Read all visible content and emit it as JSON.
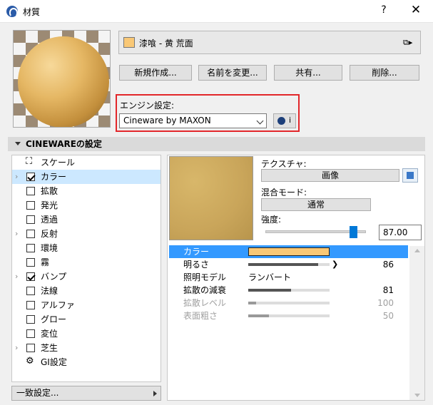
{
  "window": {
    "title": "材質",
    "help": "?",
    "close": "✕"
  },
  "material": {
    "name": "漆喰 - 黄 荒面",
    "swatch_color": "#f9c876"
  },
  "buttons": {
    "new": "新規作成...",
    "rename": "名前を変更...",
    "share": "共有...",
    "delete": "削除..."
  },
  "engine": {
    "label": "エンジン設定:",
    "value": "Cineware by MAXON",
    "info": "i"
  },
  "section": {
    "title": "CINEWAREの設定"
  },
  "channels": [
    {
      "label": "スケール",
      "type": "scale",
      "checked": false,
      "expander": false
    },
    {
      "label": "カラー",
      "type": "checkbox",
      "checked": true,
      "expander": true,
      "selected": true
    },
    {
      "label": "拡散",
      "type": "checkbox",
      "checked": false,
      "expander": false
    },
    {
      "label": "発光",
      "type": "checkbox",
      "checked": false,
      "expander": false
    },
    {
      "label": "透過",
      "type": "checkbox",
      "checked": false,
      "expander": false
    },
    {
      "label": "反射",
      "type": "checkbox",
      "checked": false,
      "expander": true
    },
    {
      "label": "環境",
      "type": "checkbox",
      "checked": false,
      "expander": false
    },
    {
      "label": "霧",
      "type": "checkbox",
      "checked": false,
      "expander": false
    },
    {
      "label": "バンプ",
      "type": "checkbox",
      "checked": true,
      "expander": true
    },
    {
      "label": "法線",
      "type": "checkbox",
      "checked": false,
      "expander": false
    },
    {
      "label": "アルファ",
      "type": "checkbox",
      "checked": false,
      "expander": false
    },
    {
      "label": "グロー",
      "type": "checkbox",
      "checked": false,
      "expander": false
    },
    {
      "label": "変位",
      "type": "checkbox",
      "checked": false,
      "expander": false
    },
    {
      "label": "芝生",
      "type": "checkbox",
      "checked": false,
      "expander": true
    },
    {
      "label": "GI設定",
      "type": "gi",
      "checked": false,
      "expander": false
    }
  ],
  "bottom_button": "一致設定...",
  "texture": {
    "label": "テクスチャ:",
    "button": "画像"
  },
  "blend": {
    "label": "混合モード:",
    "button": "通常"
  },
  "strength": {
    "label": "強度:",
    "value": "87.00",
    "fraction": 0.87
  },
  "properties": [
    {
      "key": "カラー",
      "kind": "color",
      "selected": true
    },
    {
      "key": "明るさ",
      "kind": "bar",
      "value": "86",
      "fraction": 0.86,
      "arrow": true
    },
    {
      "key": "照明モデル",
      "kind": "text",
      "text": "ランバート"
    },
    {
      "key": "拡散の減衰",
      "kind": "bar",
      "value": "81",
      "fraction": 0.53
    },
    {
      "key": "拡散レベル",
      "kind": "bar",
      "value": "100",
      "fraction": 0.1,
      "dim": true
    },
    {
      "key": "表面粗さ",
      "kind": "bar",
      "value": "50",
      "fraction": 0.25,
      "dim": true
    }
  ]
}
